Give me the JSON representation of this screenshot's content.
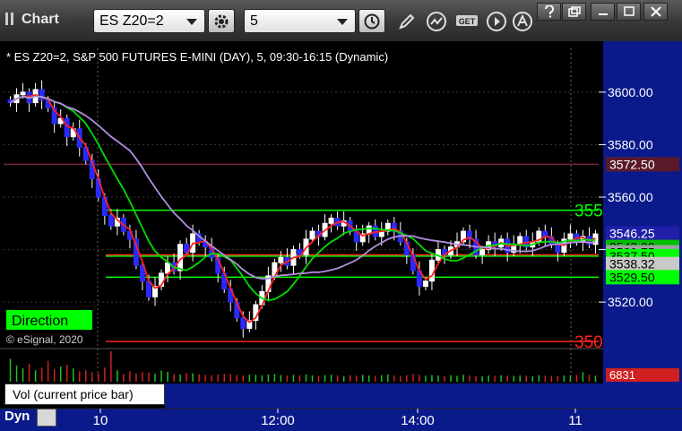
{
  "window": {
    "title": "Chart",
    "symbol_value": "ES Z20=2",
    "interval_value": "5"
  },
  "chart_data": {
    "type": "candlestick",
    "header": "* ES Z20=2, S&P 500 FUTURES E-MINI (DAY), 5, 09:30-16:15 (Dynamic)",
    "copyright": "© eSignal, 2020",
    "direction_label": "Direction",
    "x_ticks": [
      "10",
      "12:00",
      "14:00",
      "11"
    ],
    "y_ticks": [
      "3600.00",
      "3580.00",
      "3560.00",
      "3540.00",
      "3520.00"
    ],
    "ylim": [
      3504,
      3616
    ],
    "levels": [
      {
        "value": 3555,
        "label": "355",
        "color": "#00ff00"
      },
      {
        "value": 3537.5,
        "label": "",
        "color": "#00ff00"
      },
      {
        "value": 3529.5,
        "label": "",
        "color": "#00ff00"
      },
      {
        "value": 3538,
        "label": "",
        "color": "#ff2020"
      },
      {
        "value": 3505,
        "label": "350",
        "color": "#ff2020"
      },
      {
        "value": 3572.5,
        "label": "",
        "color": "#7a2040"
      }
    ],
    "price_tags": [
      {
        "value": 3572.5,
        "text": "3572.50",
        "bg": "#5a1a2a",
        "fg": "#ffffff"
      },
      {
        "value": 3546.25,
        "text": "3546.25",
        "bg": "#1f1fa8",
        "fg": "#ffffff"
      },
      {
        "value": 3541,
        "text": "3542.00",
        "bg": "#00c000",
        "fg": "#000000"
      },
      {
        "value": 3539,
        "text": "3539.75",
        "bg": "#a0a0a0",
        "fg": "#000000"
      },
      {
        "value": 3537.5,
        "text": "3537.50",
        "bg": "#00ff00",
        "fg": "#000000"
      },
      {
        "value": 3534.5,
        "text": "3538.32",
        "bg": "#c8c8c8",
        "fg": "#000000"
      },
      {
        "value": 3529.5,
        "text": "3529.50",
        "bg": "#00ff00",
        "fg": "#000000"
      }
    ],
    "closes": [
      3596,
      3599,
      3600,
      3596,
      3601,
      3597,
      3594,
      3588,
      3590,
      3583,
      3586,
      3579,
      3574,
      3567,
      3560,
      3553,
      3549,
      3552,
      3547,
      3544,
      3534,
      3528,
      3522,
      3526,
      3531,
      3535,
      3532,
      3542,
      3539,
      3546,
      3543,
      3541,
      3537,
      3531,
      3525,
      3520,
      3514,
      3510,
      3513,
      3519,
      3524,
      3530,
      3535,
      3537,
      3534,
      3540,
      3538,
      3544,
      3547,
      3545,
      3550,
      3552,
      3549,
      3551,
      3547,
      3543,
      3546,
      3549,
      3545,
      3547,
      3550,
      3547,
      3543,
      3538,
      3532,
      3526,
      3528,
      3536,
      3540,
      3538,
      3541,
      3543,
      3547,
      3544,
      3538,
      3540,
      3543,
      3541,
      3544,
      3539,
      3542,
      3545,
      3541,
      3543,
      3547,
      3545,
      3542,
      3539,
      3544,
      3546,
      3543,
      3545,
      3542,
      3546
    ],
    "volume": [
      120,
      85,
      70,
      95,
      60,
      75,
      110,
      65,
      80,
      90,
      70,
      55,
      60,
      50,
      45,
      75,
      160,
      60,
      40,
      55,
      45,
      50,
      48,
      42,
      58,
      52,
      40,
      38,
      46,
      44,
      40,
      36,
      34,
      38,
      42,
      40,
      35,
      33,
      37,
      36,
      34,
      38,
      41,
      35,
      32,
      36,
      34,
      38,
      33,
      31,
      35,
      37,
      33,
      30,
      34,
      32,
      36,
      33,
      31,
      35,
      38,
      33,
      30,
      34,
      40,
      36,
      32,
      35,
      33,
      30,
      34,
      31,
      36,
      33,
      30,
      29,
      33,
      31,
      34,
      32,
      30,
      33,
      31,
      29,
      35,
      32,
      30,
      31,
      33,
      34,
      36,
      50,
      38,
      32
    ],
    "volume_tag": "6831",
    "volume_panel_label": "Vol (current price bar)",
    "dyn_label": "Dyn"
  }
}
